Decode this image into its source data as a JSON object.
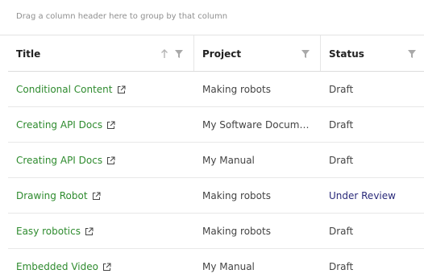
{
  "group_panel": {
    "hint": "Drag a column header here to group by that column"
  },
  "columns": [
    {
      "label": "Title",
      "sorted": "ascending",
      "filter_icon": "filter-icon",
      "sort_icon": "arrow-up-icon"
    },
    {
      "label": "Project",
      "filter_icon": "filter-icon"
    },
    {
      "label": "Status",
      "filter_icon": "filter-icon"
    }
  ],
  "rows": [
    {
      "title": "Conditional Content",
      "project": "Making robots",
      "status": "Draft"
    },
    {
      "title": "Creating API Docs",
      "project": "My Software Documentation",
      "status": "Draft"
    },
    {
      "title": "Creating API Docs",
      "project": "My Manual",
      "status": "Draft"
    },
    {
      "title": "Drawing Robot",
      "project": "Making robots",
      "status": "Under Review"
    },
    {
      "title": "Easy robotics",
      "project": "Making robots",
      "status": "Draft"
    },
    {
      "title": "Embedded Video",
      "project": "My Manual",
      "status": "Draft"
    }
  ],
  "colors": {
    "title_link": "#2e8b2e",
    "status_under_review": "#2a2a7a",
    "status_default": "#444444"
  },
  "icons": {
    "external_link": "external-link-icon"
  }
}
